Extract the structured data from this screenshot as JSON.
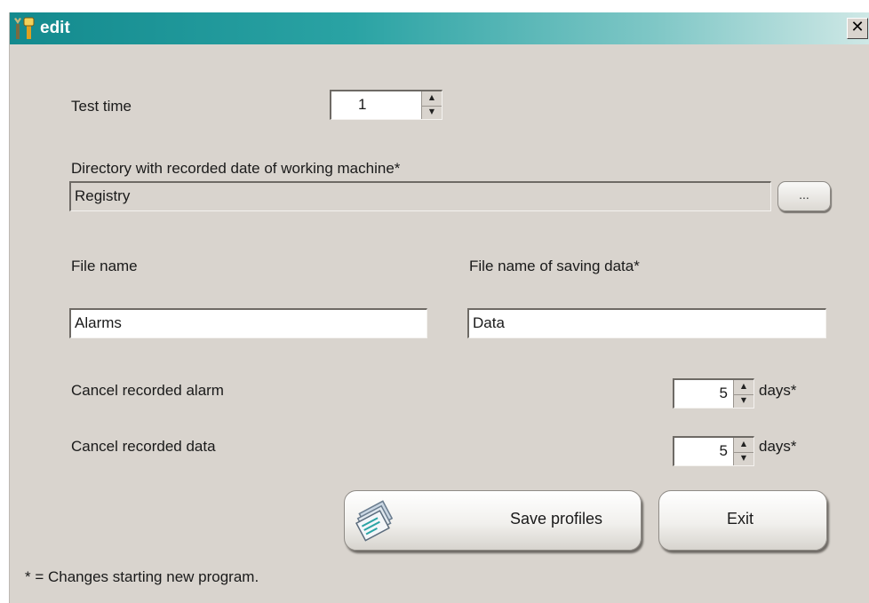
{
  "window": {
    "title": "edit",
    "close_label": "✕"
  },
  "form": {
    "test_time": {
      "label": "Test time",
      "value": "1"
    },
    "directory": {
      "label": "Directory with recorded date of working machine*",
      "value": "Registry",
      "browse_label": "..."
    },
    "file_name": {
      "label": "File name",
      "value": "Alarms"
    },
    "saving_file_name": {
      "label": "File name of saving data*",
      "value": "Data"
    },
    "cancel_alarm": {
      "label": "Cancel recorded alarm",
      "value": "5",
      "unit": "days*"
    },
    "cancel_data": {
      "label": "Cancel recorded data",
      "value": "5",
      "unit": "days*"
    }
  },
  "buttons": {
    "save_label": "Save profiles",
    "exit_label": "Exit"
  },
  "footer": {
    "note": "* = Changes starting new program."
  },
  "icons": {
    "title": "tools-icon",
    "save": "document-stack-icon",
    "spin_up": "▲",
    "spin_down": "▼"
  },
  "colors": {
    "titlebar_start": "#138a8e",
    "titlebar_end": "#cfe8e6",
    "window_bg": "#d9d4ce"
  }
}
